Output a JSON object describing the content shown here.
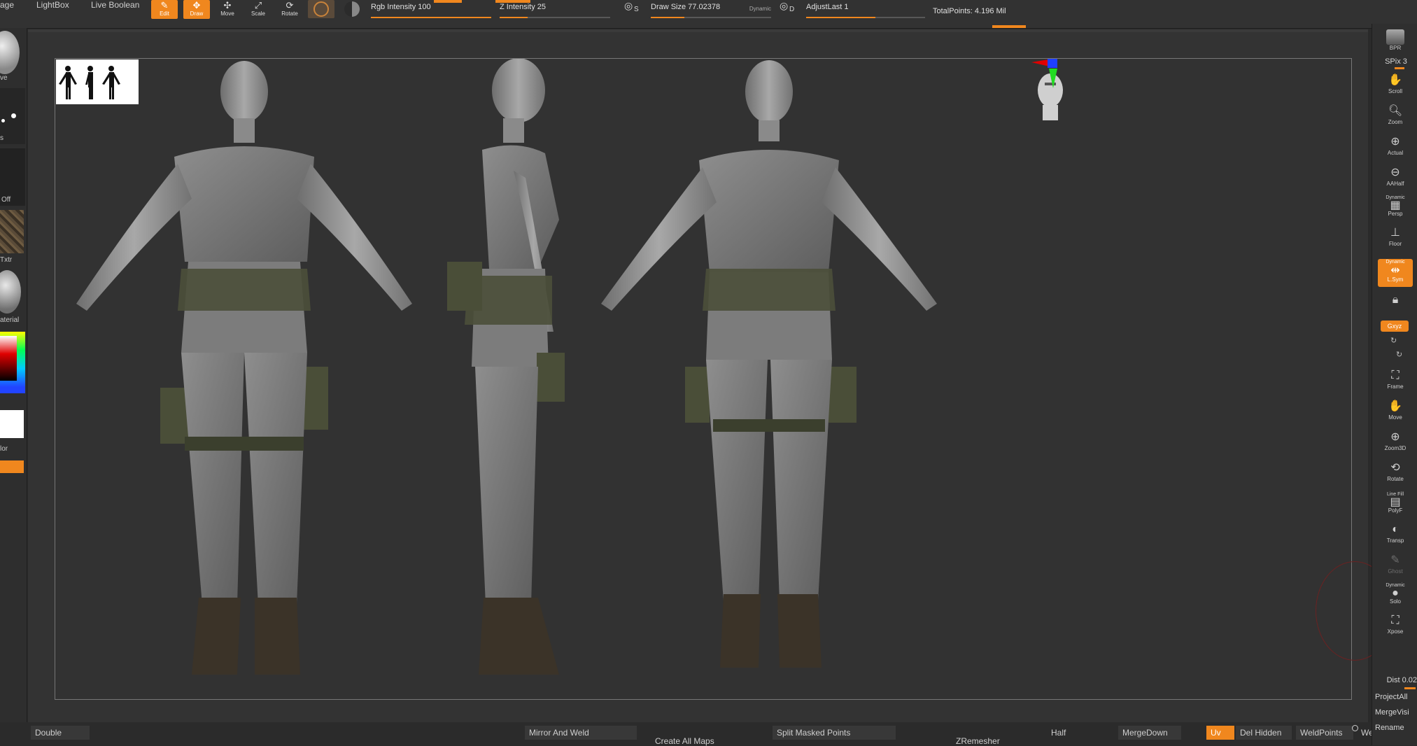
{
  "topbar": {
    "tabs": [
      {
        "label": "age"
      },
      {
        "label": "LightBox"
      },
      {
        "label": "Live Boolean"
      }
    ],
    "tools": [
      {
        "label": "Edit",
        "icon": "edit-icon",
        "active": true
      },
      {
        "label": "Draw",
        "icon": "draw-icon",
        "active": true
      },
      {
        "label": "Move",
        "icon": "move-icon",
        "active": false
      },
      {
        "label": "Scale",
        "icon": "scale-icon",
        "active": false
      },
      {
        "label": "Rotate",
        "icon": "rotate-icon",
        "active": false
      }
    ],
    "rgb_intensity": {
      "label": "Rgb Intensity 100",
      "value": 100
    },
    "z_intensity": {
      "label": "Z Intensity 25",
      "value": 25
    },
    "draw_size": {
      "label": "Draw Size 77.02378",
      "value": 77.02378,
      "mode": "Dynamic"
    },
    "adjust_last": {
      "label": "AdjustLast 1",
      "value": 1
    },
    "sym_s_label": "S",
    "sym_d_label": "D",
    "total_points": "TotalPoints: 4.196 Mil"
  },
  "leftbar": {
    "labels": [
      "ve",
      "s",
      "Off",
      "Txtr",
      "aterial",
      "lor"
    ]
  },
  "rightbar": {
    "spix": "SPix 3",
    "buttons": [
      {
        "label": "BPR",
        "icon": "bpr-icon",
        "active": false,
        "dim": false
      },
      {
        "label": "Scroll",
        "icon": "scroll-hand-icon",
        "active": false,
        "dim": false
      },
      {
        "label": "Zoom",
        "icon": "zoom-icon",
        "active": false,
        "dim": false
      },
      {
        "label": "Actual",
        "icon": "actual-size-icon",
        "active": false,
        "dim": false
      },
      {
        "label": "AAHalf",
        "icon": "aahalf-icon",
        "active": false,
        "dim": false
      },
      {
        "label": "Persp",
        "icon": "perspective-icon",
        "active": false,
        "dim": false,
        "caption": "Dynamic"
      },
      {
        "label": "Floor",
        "icon": "floor-icon",
        "active": false,
        "dim": false
      },
      {
        "label": "L.Sym",
        "icon": "local-symmetry-icon",
        "active": true,
        "dim": false,
        "caption": "Dynamic"
      },
      {
        "label": "",
        "icon": "lock-icon",
        "active": false,
        "dim": false
      },
      {
        "label": "Frame",
        "icon": "frame-icon",
        "active": false,
        "dim": false
      },
      {
        "label": "Move",
        "icon": "move-hand-icon",
        "active": false,
        "dim": false
      },
      {
        "label": "Zoom3D",
        "icon": "zoom3d-icon",
        "active": false,
        "dim": false
      },
      {
        "label": "Rotate",
        "icon": "rotate3d-icon",
        "active": false,
        "dim": false
      },
      {
        "label": "PolyF",
        "icon": "polyframe-icon",
        "active": false,
        "dim": false,
        "caption": "Line Fill"
      },
      {
        "label": "Transp",
        "icon": "transparency-icon",
        "active": false,
        "dim": false
      },
      {
        "label": "Ghost",
        "icon": "ghost-icon",
        "active": false,
        "dim": true
      },
      {
        "label": "Solo",
        "icon": "solo-icon",
        "active": false,
        "dim": false,
        "caption": "Dynamic"
      },
      {
        "label": "Xpose",
        "icon": "xpose-icon",
        "active": false,
        "dim": false
      }
    ],
    "xyz_label": "Gxyz",
    "dist": "Dist 0.02",
    "project_all": "ProjectAll",
    "merge_visible": "MergeVisi",
    "rename": "Rename"
  },
  "bottombar": {
    "double": "Double",
    "mirror_and_weld": "Mirror And Weld",
    "create_all_maps": "Create All Maps",
    "split_masked_points": "Split Masked Points",
    "zremesher": "ZRemesher",
    "half": "Half",
    "merge_down": "MergeDown",
    "uv": "Uv",
    "del_hidden": "Del Hidden",
    "weld_points": "WeldPoints",
    "we": "We"
  },
  "viewport": {
    "reference_thumbnail": "silhouettes-icon",
    "navigation_head": "navigation-head-icon",
    "figures": [
      "figure-back-view",
      "figure-side-view",
      "figure-front-view"
    ]
  },
  "colors": {
    "accent": "#f0871e",
    "panel": "#323232",
    "canvas": "#333333"
  }
}
